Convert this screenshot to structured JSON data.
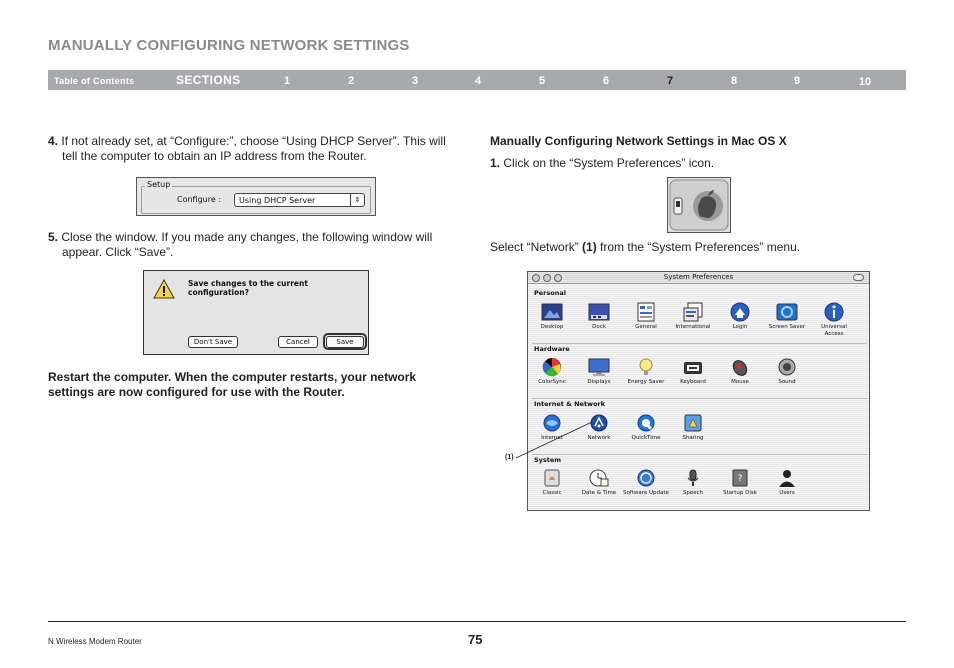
{
  "header": {
    "title": "MANUALLY CONFIGURING NETWORK SETTINGS"
  },
  "nav": {
    "toc_label": "Table of Contents",
    "sections_label": "SECTIONS",
    "numbers": [
      "1",
      "2",
      "3",
      "4",
      "5",
      "6",
      "7",
      "8",
      "9",
      "10"
    ],
    "active": "7"
  },
  "left": {
    "step4_num": "4.",
    "step4_text": "If not already set, at “Configure:”, choose “Using DHCP Server”. This will tell the computer to obtain an IP address from the Router.",
    "setup_title": "Setup",
    "configure_label": "Configure :",
    "configure_value": "Using DHCP Server",
    "step5_num": "5.",
    "step5_text": "Close the window. If you made any changes, the following window will appear. Click “Save”.",
    "dialog_message": "Save changes to the current configuration?",
    "dialog_dont_save": "Don't Save",
    "dialog_cancel": "Cancel",
    "dialog_save": "Save",
    "restart_note": "Restart the computer. When the computer restarts, your network settings are now configured for use with the Router."
  },
  "right": {
    "heading": "Manually Configuring Network Settings in Mac OS X",
    "step1_num": "1.",
    "step1_text": "Click on the “System Preferences” icon.",
    "select_pre": "Select “Network” ",
    "select_bold": "(1)",
    "select_post": " from the “System Preferences” menu.",
    "callout": "(1)"
  },
  "sysprefs": {
    "window_title": "System Preferences",
    "sections": [
      {
        "label": "Personal",
        "items": [
          {
            "label": "Desktop",
            "icon": "desktop-icon"
          },
          {
            "label": "Dock",
            "icon": "dock-icon"
          },
          {
            "label": "General",
            "icon": "general-icon"
          },
          {
            "label": "International",
            "icon": "international-icon"
          },
          {
            "label": "Login",
            "icon": "login-icon"
          },
          {
            "label": "Screen Saver",
            "icon": "screen-saver-icon"
          },
          {
            "label": "Universal Access",
            "icon": "universal-access-icon"
          }
        ]
      },
      {
        "label": "Hardware",
        "items": [
          {
            "label": "ColorSync",
            "icon": "colorsync-icon"
          },
          {
            "label": "Displays",
            "icon": "displays-icon"
          },
          {
            "label": "Energy Saver",
            "icon": "energy-saver-icon"
          },
          {
            "label": "Keyboard",
            "icon": "keyboard-icon"
          },
          {
            "label": "Mouse",
            "icon": "mouse-icon"
          },
          {
            "label": "Sound",
            "icon": "sound-icon"
          }
        ]
      },
      {
        "label": "Internet & Network",
        "items": [
          {
            "label": "Internet",
            "icon": "internet-icon"
          },
          {
            "label": "Network",
            "icon": "network-icon"
          },
          {
            "label": "QuickTime",
            "icon": "quicktime-icon"
          },
          {
            "label": "Sharing",
            "icon": "sharing-icon"
          }
        ]
      },
      {
        "label": "System",
        "items": [
          {
            "label": "Classic",
            "icon": "classic-icon"
          },
          {
            "label": "Date & Time",
            "icon": "date-time-icon"
          },
          {
            "label": "Software Update",
            "icon": "software-update-icon"
          },
          {
            "label": "Speech",
            "icon": "speech-icon"
          },
          {
            "label": "Startup Disk",
            "icon": "startup-disk-icon"
          },
          {
            "label": "Users",
            "icon": "users-icon"
          }
        ]
      }
    ]
  },
  "footer": {
    "product": "N Wireless Modem Router",
    "page": "75"
  },
  "colors": {
    "nav_bg": "#a7a9ac",
    "heading_gray": "#8a8a8a",
    "text": "#231f20"
  }
}
